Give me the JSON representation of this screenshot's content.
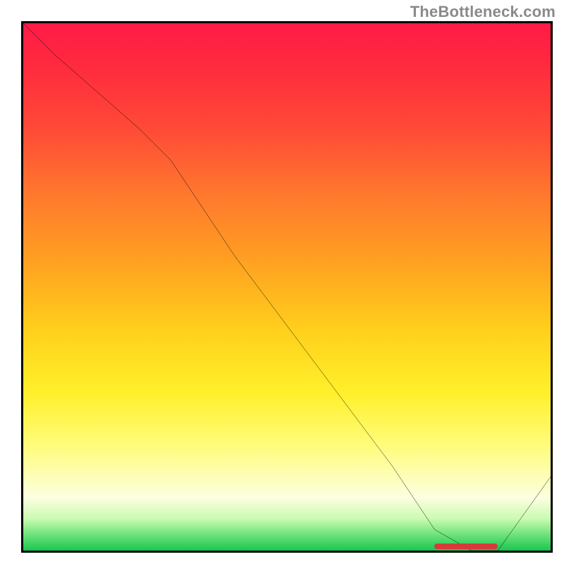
{
  "watermark": "TheBottleneck.com",
  "chart_data": {
    "type": "line",
    "title": "",
    "xlabel": "",
    "ylabel": "",
    "xlim": [
      0,
      100
    ],
    "ylim": [
      0,
      100
    ],
    "grid": false,
    "series": [
      {
        "name": "curve",
        "x": [
          0,
          6,
          22,
          28,
          40,
          55,
          70,
          78,
          85,
          90,
          100
        ],
        "y": [
          100,
          94,
          80,
          74,
          56,
          36,
          16,
          4,
          0,
          0,
          14
        ]
      }
    ],
    "optimum_band": {
      "x_start": 78,
      "x_end": 90,
      "y": 0
    },
    "background": {
      "type": "vertical-gradient",
      "stops": [
        {
          "pos": 0.0,
          "color": "#ff1a46"
        },
        {
          "pos": 0.33,
          "color": "#ff7a2d"
        },
        {
          "pos": 0.58,
          "color": "#ffcf1c"
        },
        {
          "pos": 0.8,
          "color": "#fffc7a"
        },
        {
          "pos": 0.97,
          "color": "#6de27b"
        },
        {
          "pos": 1.0,
          "color": "#19c650"
        }
      ]
    }
  }
}
